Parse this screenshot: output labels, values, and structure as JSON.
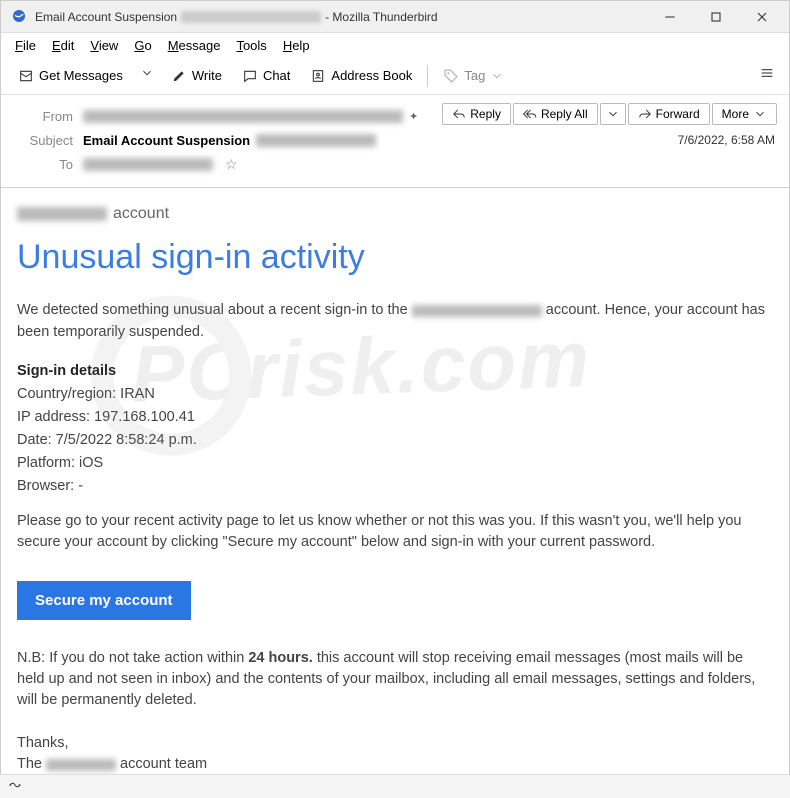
{
  "window": {
    "title_prefix": "Email Account Suspension",
    "title_suffix": "- Mozilla Thunderbird"
  },
  "menu": {
    "file": "File",
    "edit": "Edit",
    "view": "View",
    "go": "Go",
    "message": "Message",
    "tools": "Tools",
    "help": "Help"
  },
  "toolbar": {
    "get_messages": "Get Messages",
    "write": "Write",
    "chat": "Chat",
    "address_book": "Address Book",
    "tag": "Tag"
  },
  "header": {
    "from_label": "From",
    "subject_label": "Subject",
    "to_label": "To",
    "subject_bold": "Email Account Suspension",
    "reply": "Reply",
    "reply_all": "Reply All",
    "forward": "Forward",
    "more": "More",
    "datetime": "7/6/2022, 6:58 AM"
  },
  "body": {
    "account_suffix": "account",
    "heading": "Unusual sign-in activity",
    "intro_a": "We detected something unusual about a recent sign-in to the ",
    "intro_b": " account. Hence, your account has been temporarily suspended.",
    "details_head": "Sign-in details",
    "country": "Country/region: IRAN",
    "ip": "IP address: 197.168.100.41",
    "date": "Date: 7/5/2022 8:58:24 p.m.",
    "platform": "Platform: iOS",
    "browser": "Browser: -",
    "please": "Please go to your recent activity page to let us know whether or not this was you. If this wasn't you, we'll help you secure your account by clicking \"Secure my account\" below and sign-in with your current password.",
    "secure_btn": "Secure my account",
    "nb_a": "N.B: If you do not take action within ",
    "nb_bold": "24 hours.",
    "nb_b": "   this account will stop receiving email messages (most mails will be held up and not seen in inbox) and the contents of your mailbox, including all email messages, settings and folders, will be permanently deleted.",
    "thanks": "Thanks,",
    "team_a": "The ",
    "team_b": " account team"
  },
  "watermark": "PCrisk.com"
}
